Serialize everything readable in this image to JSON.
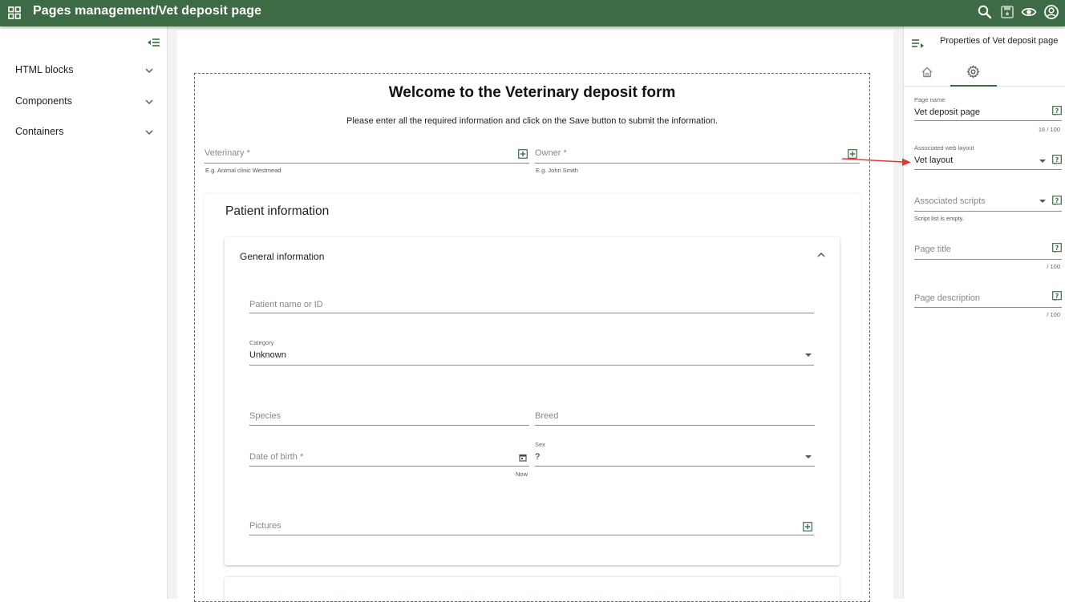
{
  "header": {
    "title": "Pages management/Vet deposit page",
    "icons": [
      "dashboard-icon",
      "search-icon",
      "save-icon",
      "eye-icon",
      "account-icon"
    ]
  },
  "left_panel": {
    "items": [
      {
        "label": "HTML blocks"
      },
      {
        "label": "Components"
      },
      {
        "label": "Containers"
      }
    ]
  },
  "form": {
    "title": "Welcome to the Veterinary deposit form",
    "subtitle": "Please enter all the required information and click on the Save button to submit the information.",
    "veterinary": {
      "label": "Veterinary *",
      "hint": "E.g. Animal clinic Westmead"
    },
    "owner": {
      "label": "Owner *",
      "hint": "E.g. John Smith"
    },
    "patient_section": "Patient information",
    "general_section": "General information",
    "patient_name": {
      "label": "Patient name or ID"
    },
    "category": {
      "label": "Category",
      "value": "Unknown"
    },
    "species": {
      "label": "Species"
    },
    "breed": {
      "label": "Breed"
    },
    "dob": {
      "label": "Date of birth *",
      "hint": "Now"
    },
    "sex": {
      "label": "Sex",
      "value": "?"
    },
    "pictures": {
      "label": "Pictures"
    }
  },
  "right_panel": {
    "title": "Properties of Vet deposit page",
    "page_name": {
      "label": "Page name",
      "value": "Vet deposit page",
      "count": "16 / 100"
    },
    "web_layout": {
      "label": "Associated web layout",
      "value": "Vet layout"
    },
    "scripts": {
      "label": "Associated scripts",
      "hint": "Script list is empty."
    },
    "page_title": {
      "label": "Page title",
      "count": "/ 100"
    },
    "page_description": {
      "label": "Page description",
      "count": "/ 100"
    }
  },
  "colors": {
    "header_bg": "#3d6b45",
    "accent": "#3d6b45",
    "annotation_arrow": "#e53935"
  }
}
